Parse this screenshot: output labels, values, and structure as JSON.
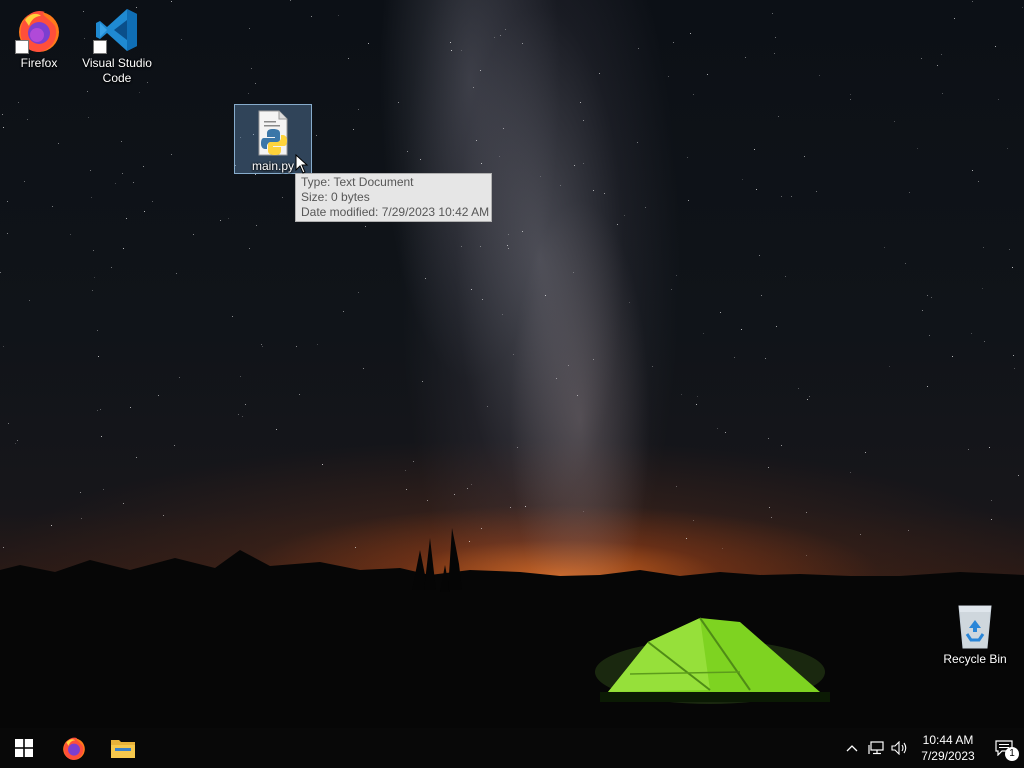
{
  "desktop": {
    "icons": [
      {
        "label": "Firefox",
        "icon": "firefox-icon"
      },
      {
        "label": "Visual Studio\nCode",
        "icon": "vscode-icon"
      },
      {
        "label": "main.py",
        "icon": "python-file-icon"
      },
      {
        "label": "Recycle Bin",
        "icon": "recycle-bin-icon"
      }
    ]
  },
  "tooltip": {
    "type": "Type: Text Document",
    "size": "Size: 0 bytes",
    "modified": "Date modified: 7/29/2023 10:42 AM"
  },
  "taskbar": {
    "pinned": [
      {
        "name": "start-button",
        "icon": "windows-logo-icon"
      },
      {
        "name": "firefox-taskbar",
        "icon": "firefox-icon"
      },
      {
        "name": "file-explorer-taskbar",
        "icon": "folder-icon"
      }
    ],
    "tray": {
      "time": "10:44 AM",
      "date": "7/29/2023",
      "notifications": "1"
    }
  },
  "colors": {
    "taskbar": "#080808",
    "tooltip_bg": "#e6e6e6",
    "selection": "#5a82aa",
    "tent_green": "#7ed321",
    "horizon_glow": "#e66e1e"
  }
}
